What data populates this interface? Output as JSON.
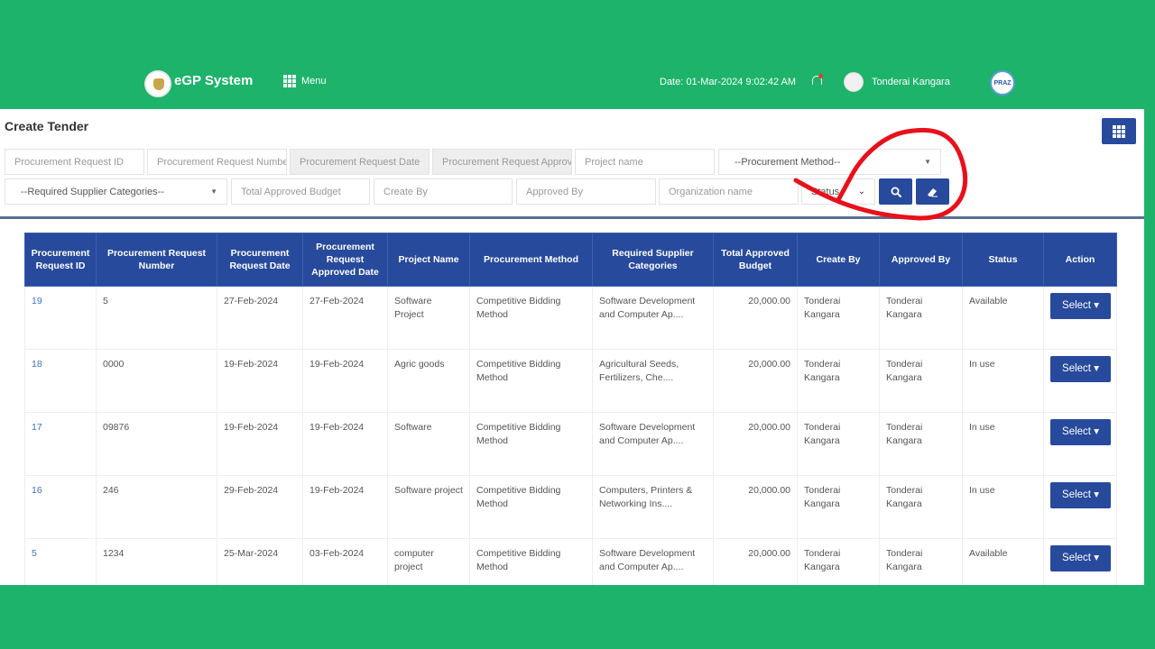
{
  "header": {
    "app_title": "eGP System",
    "menu_label": "Menu",
    "date_text": "Date: 01-Mar-2024 9:02:42 AM",
    "user_name": "Tonderai Kangara",
    "partner_logo_text": "PRAZ"
  },
  "page": {
    "title": "Create Tender"
  },
  "filters": {
    "request_id": "Procurement Request ID",
    "request_number": "Procurement Request Number",
    "request_date": "Procurement Request Date",
    "request_approved": "Procurement Request Approved Date",
    "project_name": "Project name",
    "procurement_method": "--Procurement Method--",
    "supplier_categories": "--Required Supplier Categories--",
    "total_budget": "Total Approved Budget",
    "create_by": "Create By",
    "approved_by": "Approved By",
    "organization": "Organization name",
    "status": "Status"
  },
  "table": {
    "headers": [
      "Procurement Request ID",
      "Procurement Request Number",
      "Procurement Request Date",
      "Procurement Request Approved Date",
      "Project Name",
      "Procurement Method",
      "Required Supplier Categories",
      "Total Approved Budget",
      "Create By",
      "Approved By",
      "Status",
      "Action"
    ],
    "action_label": "Select",
    "rows": [
      [
        "19",
        "5",
        "27-Feb-2024",
        "27-Feb-2024",
        "Software Project",
        "Competitive Bidding Method",
        "Software Development and Computer Ap....",
        "20,000.00",
        "Tonderai Kangara",
        "Tonderai Kangara",
        "Available"
      ],
      [
        "18",
        "0000",
        "19-Feb-2024",
        "19-Feb-2024",
        "Agric goods",
        "Competitive Bidding Method",
        "Agricultural Seeds, Fertilizers, Che....",
        "20,000.00",
        "Tonderai Kangara",
        "Tonderai Kangara",
        "In use"
      ],
      [
        "17",
        "09876",
        "19-Feb-2024",
        "19-Feb-2024",
        "Software",
        "Competitive Bidding Method",
        "Software Development and Computer Ap....",
        "20,000.00",
        "Tonderai Kangara",
        "Tonderai Kangara",
        "In use"
      ],
      [
        "16",
        "246",
        "29-Feb-2024",
        "19-Feb-2024",
        "Software project",
        "Competitive Bidding Method",
        "Computers, Printers & Networking Ins....",
        "20,000.00",
        "Tonderai Kangara",
        "Tonderai Kangara",
        "In use"
      ],
      [
        "5",
        "1234",
        "25-Mar-2024",
        "03-Feb-2024",
        "computer project",
        "Competitive Bidding Method",
        "Software Development and Computer Ap....",
        "20,000.00",
        "Tonderai Kangara",
        "Tonderai Kangara",
        "Available"
      ]
    ]
  },
  "colors": {
    "brand_green": "#1db36b",
    "primary_blue": "#274a9c",
    "link_blue": "#3b73b9",
    "annotation_red": "#e8101b"
  }
}
